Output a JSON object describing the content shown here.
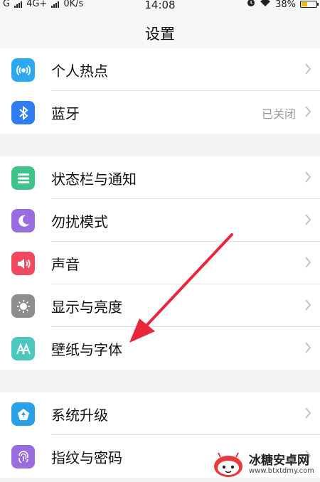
{
  "status": {
    "carrier1": "G",
    "carrier2": "4G+",
    "speed": "0K/s",
    "time": "14:08",
    "battery": "38%",
    "battery_level": 0.38
  },
  "header": {
    "title": "设置"
  },
  "groups": [
    {
      "items": [
        {
          "label": "个人热点",
          "icon": "hotspot-icon",
          "color": "#2aa8f0",
          "value": ""
        },
        {
          "label": "蓝牙",
          "icon": "bluetooth-icon",
          "color": "#2f7df0",
          "value": "已关闭"
        }
      ]
    },
    {
      "items": [
        {
          "label": "状态栏与通知",
          "icon": "statusbar-notification-icon",
          "color": "#3ec48b",
          "value": ""
        },
        {
          "label": "勿扰模式",
          "icon": "moon-icon",
          "color": "#9b6ce0",
          "value": ""
        },
        {
          "label": "声音",
          "icon": "speaker-icon",
          "color": "#f04a5c",
          "value": ""
        },
        {
          "label": "显示与亮度",
          "icon": "brightness-icon",
          "color": "#8d8d8d",
          "value": ""
        },
        {
          "label": "壁纸与字体",
          "icon": "wallpaper-font-icon",
          "color": "#4ec6c0",
          "value": ""
        }
      ]
    },
    {
      "items": [
        {
          "label": "系统升级",
          "icon": "system-update-icon",
          "color": "#2aa0e8",
          "value": ""
        },
        {
          "label": "指纹与密码",
          "icon": "fingerprint-icon",
          "color": "#9b6ce0",
          "value": ""
        }
      ]
    }
  ],
  "watermark": {
    "name": "冰糖安卓网",
    "url": "www.btxtdmy.com"
  }
}
